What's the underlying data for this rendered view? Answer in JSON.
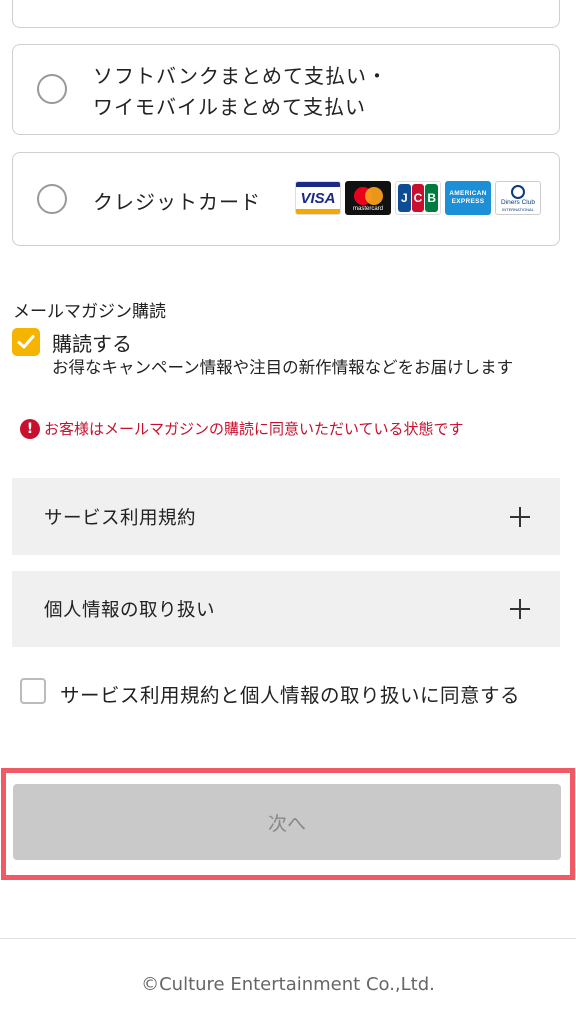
{
  "payment": {
    "softbank_line1": "ソフトバンクまとめて支払い・",
    "softbank_line2": "ワイモバイルまとめて支払い",
    "credit_label": "クレジットカード",
    "brands": {
      "visa": "VISA",
      "mastercard": "mastercard",
      "jcb": [
        "J",
        "C",
        "B"
      ],
      "amex_line1": "AMERICAN",
      "amex_line2": "EXPRESS",
      "diners_line1": "Diners Club",
      "diners_line2": "INTERNATIONAL"
    }
  },
  "newsletter": {
    "heading": "メールマガジン購読",
    "checkbox_label": "購読する",
    "checked": true,
    "description": "お得なキャンペーン情報や注目の新作情報などをお届けします",
    "notice": "お客様はメールマガジンの購読に同意いただいている状態です"
  },
  "accordions": {
    "terms": "サービス利用規約",
    "privacy": "個人情報の取り扱い"
  },
  "agreement": {
    "label": "サービス利用規約と個人情報の取り扱いに同意する",
    "checked": false
  },
  "next_button": "次へ",
  "footer": {
    "copyright": "©Culture Entertainment Co.,Ltd."
  },
  "colors": {
    "accent_checkbox": "#f4b400",
    "notice_red": "#c8102e",
    "highlight_border": "#f05a64",
    "disabled_button": "#c9c9c9"
  }
}
